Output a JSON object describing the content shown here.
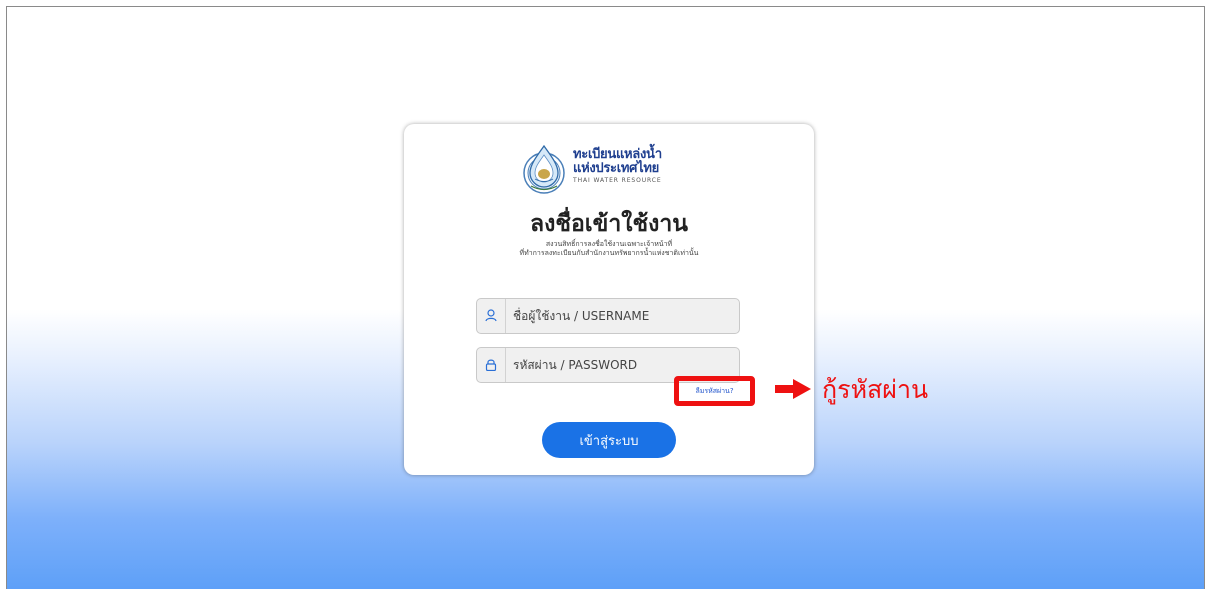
{
  "brand": {
    "line1": "ทะเบียนแหล่งน้ำ",
    "line2": "แห่งประเทศไทย",
    "tagline": "THAI WATER RESOURCE"
  },
  "login": {
    "title": "ลงชื่อเข้าใช้งาน",
    "subtitle_line1": "สงวนสิทธิ์การลงชื่อใช้งานเฉพาะเจ้าหน้าที่",
    "subtitle_line2": "ที่ทำการลงทะเบียนกับสำนักงานทรัพยากรน้ำแห่งชาติเท่านั้น",
    "username_placeholder": "ชื่อผู้ใช้งาน / USERNAME",
    "password_placeholder": "รหัสผ่าน / PASSWORD",
    "forgot_password": "ลืมรหัสผ่าน?",
    "submit": "เข้าสู่ระบบ"
  },
  "annotation": {
    "label": "กู้รหัสผ่าน",
    "color": "#ee1111"
  },
  "icons": {
    "username": "user-icon",
    "password": "lock-icon",
    "emblem": "water-drop-emblem-icon",
    "arrow": "arrow-right-icon"
  },
  "colors": {
    "primary_button": "#1a72e6",
    "brand_text": "#1f3f8f",
    "link": "#2255cc"
  }
}
